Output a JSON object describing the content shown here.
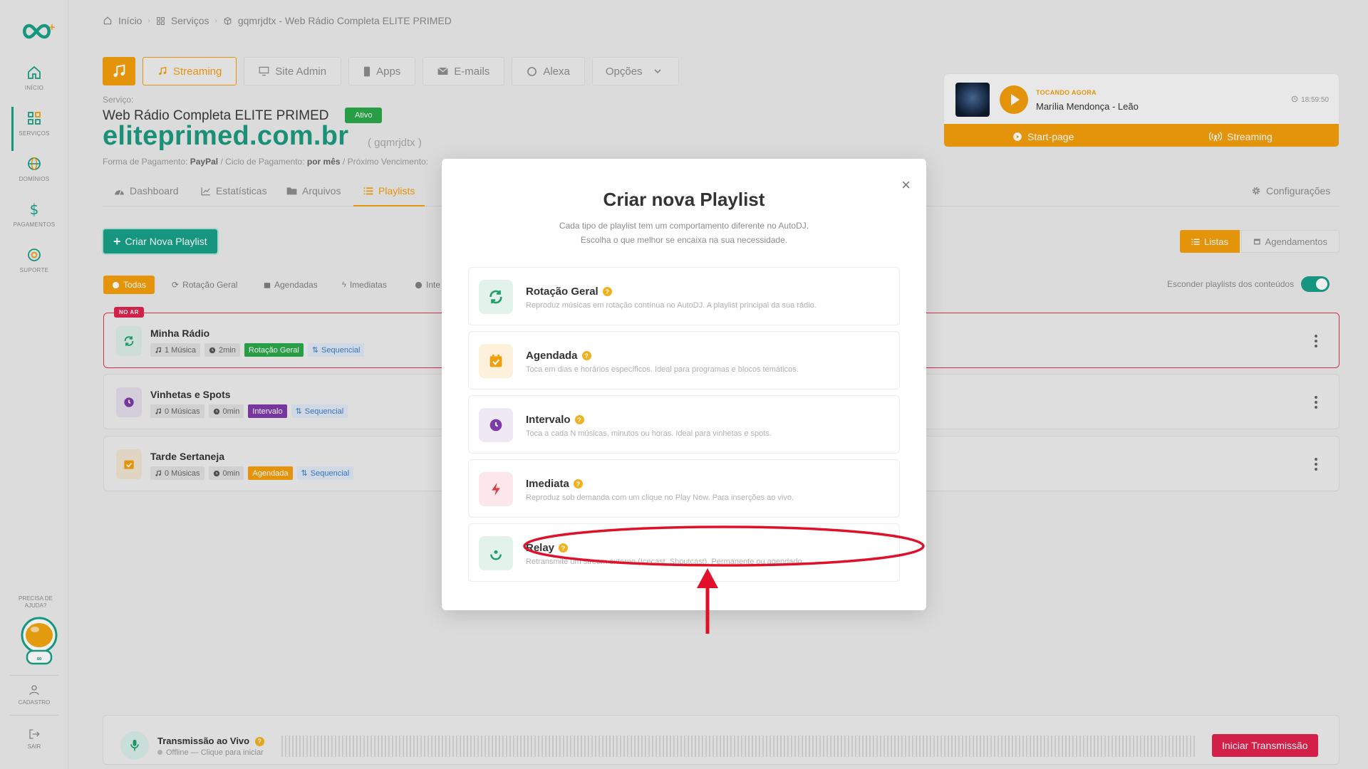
{
  "sidebar": {
    "items": [
      {
        "label": "INÍCIO"
      },
      {
        "label": "SERVIÇOS"
      },
      {
        "label": "DOMÍNIOS"
      },
      {
        "label": "PAGAMENTOS"
      },
      {
        "label": "SUPORTE"
      }
    ],
    "help": "PRECISA DE AJUDA?",
    "cadastro": "CADASTRO",
    "sair": "SAIR"
  },
  "breadcrumb": {
    "home": "Início",
    "services": "Serviços",
    "current": "gqmrjdtx - Web Rádio Completa ELITE PRIMED"
  },
  "top_tabs": {
    "streaming": "Streaming",
    "site_admin": "Site Admin",
    "apps": "Apps",
    "emails": "E-mails",
    "alexa": "Alexa",
    "opcoes": "Opções"
  },
  "service": {
    "label": "Serviço:",
    "name": "Web Rádio Completa ELITE PRIMED",
    "status": "Ativo",
    "domain": "eliteprimed.com.br",
    "id": "( gqmrjdtx )",
    "payment_label": "Forma de Pagamento:",
    "payment_value": "PayPal",
    "cycle_label": "/ Ciclo de Pagamento:",
    "cycle_value": "por mês",
    "next_label": "/ Próximo Vencimento:"
  },
  "now_playing": {
    "label": "TOCANDO AGORA",
    "song": "Marília Mendonça - Leão",
    "time": "18:59:50",
    "start_page": "Start-page",
    "streaming": "Streaming"
  },
  "sub_tabs": {
    "dashboard": "Dashboard",
    "estatisticas": "Estatísticas",
    "arquivos": "Arquivos",
    "playlists": "Playlists",
    "configuracoes": "Configurações"
  },
  "actions": {
    "create": "Criar Nova Playlist",
    "listas": "Listas",
    "agendamentos": "Agendamentos"
  },
  "filters": {
    "todas": "Todas",
    "rotacao": "Rotação Geral",
    "agendadas": "Agendadas",
    "imediatas": "Imediatas",
    "inte": "Inte",
    "hide_label": "Esconder playlists dos conteúdos"
  },
  "playlists": [
    {
      "name": "Minha Rádio",
      "badge": "NO AR",
      "songs": "1 Música",
      "duration": "2min",
      "type": "Rotação Geral",
      "mode": "Sequencial"
    },
    {
      "name": "Vinhetas e Spots",
      "songs": "0 Músicas",
      "duration": "0min",
      "type": "Intervalo",
      "mode": "Sequencial"
    },
    {
      "name": "Tarde Sertaneja",
      "songs": "0 Músicas",
      "duration": "0min",
      "type": "Agendada",
      "mode": "Sequencial"
    }
  ],
  "live": {
    "title": "Transmissão ao Vivo",
    "status": "Offline — Clique para iniciar",
    "button": "Iniciar Transmissão"
  },
  "modal": {
    "title": "Criar nova Playlist",
    "desc1": "Cada tipo de playlist tem um comportamento diferente no AutoDJ.",
    "desc2": "Escolha o que melhor se encaixa na sua necessidade.",
    "close": "×",
    "options": [
      {
        "title": "Rotação Geral",
        "desc": "Reproduz músicas em rotação contínua no AutoDJ. A playlist principal da sua rádio."
      },
      {
        "title": "Agendada",
        "desc": "Toca em dias e horários específicos. Ideal para programas e blocos temáticos."
      },
      {
        "title": "Intervalo",
        "desc": "Toca a cada N músicas, minutos ou horas. Ideal para vinhetas e spots."
      },
      {
        "title": "Imediata",
        "desc": "Reproduz sob demanda com um clique no Play Now. Para inserções ao vivo."
      },
      {
        "title": "Relay",
        "desc": "Retransmite um stream externo (Icecast, Shoutcast). Permanente ou agendado."
      }
    ]
  },
  "colors": {
    "brand_green": "#18a086",
    "accent_orange": "#f29e0c",
    "onair_red": "#e0224d",
    "annotation_red": "#e0102a"
  }
}
